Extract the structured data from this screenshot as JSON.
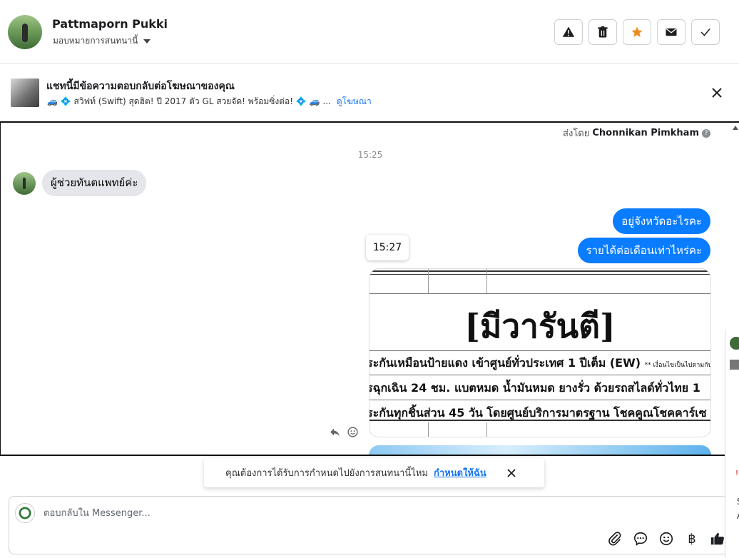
{
  "header": {
    "contact_name": "Pattmaporn Pukki",
    "assign_label": "มอบหมายการสนทนานี้",
    "icons": [
      "warning-icon",
      "trash-icon",
      "star-icon",
      "envelope-icon",
      "check-icon"
    ],
    "star_color": "#f28b1e"
  },
  "ad": {
    "title": "แชทนี้มีข้อความตอบกลับต่อโฆษณาของคุณ",
    "snippet": "🚙 💠 สวิฟท์ (Swift) สุดฮิต! ปี 2017 ตัว GL สวยจัด! พร้อมซิ่งต่อ! 💠 🚙 ...",
    "link": "ดูโฆษณา"
  },
  "conversation": {
    "sent_by_prefix": "ส่งโดย",
    "sent_by_name": "Chonnikan Pimkham",
    "time_1": "15:25",
    "incoming_1": "ผู้ช่วยทันตแพทย์ค่ะ",
    "outgoing_1": "อยู่จังหวัดอะไรคะ",
    "outgoing_2": "รายได้ต่อเดือนเท่าไหร่คะ",
    "tooltip_time": "15:27",
    "image": {
      "headline": "[มีวารันตี]",
      "line_1": "ระกันเหมือนป้ายแดง เข้าศูนย์ทั่วประเทศ 1 ปีเต็ม (EW)",
      "line_1_small": "** เงื่อนไขเป็นไปตามกับ",
      "line_2": "รฉุกเฉิน 24 ชม. แบตหมด น้ำมันหมด ยางรั่ว ด้วยรถสไลด์ทั่วไทย 1",
      "line_3": "ระกันทุกชิ้นส่วน 45 วัน โดยศูนย์บริการมาตรฐาน โชคคูณโชคคาร์เซ"
    },
    "accent_color": "#0a7cff"
  },
  "notice": {
    "text": "คุณต้องการได้รับการกำหนดไปยังการสนทนานี้ไหม",
    "link": "กำหนดให้ฉัน"
  },
  "composer": {
    "placeholder": "ตอบกลับใน Messenger...",
    "baht_symbol": "฿",
    "tools": [
      "paperclip-icon",
      "saved-reply-icon",
      "emoji-icon",
      "baht-icon",
      "thumbs-up-icon"
    ]
  },
  "edge": {
    "letter_1": "S",
    "letter_2": "A",
    "mark": "!"
  }
}
